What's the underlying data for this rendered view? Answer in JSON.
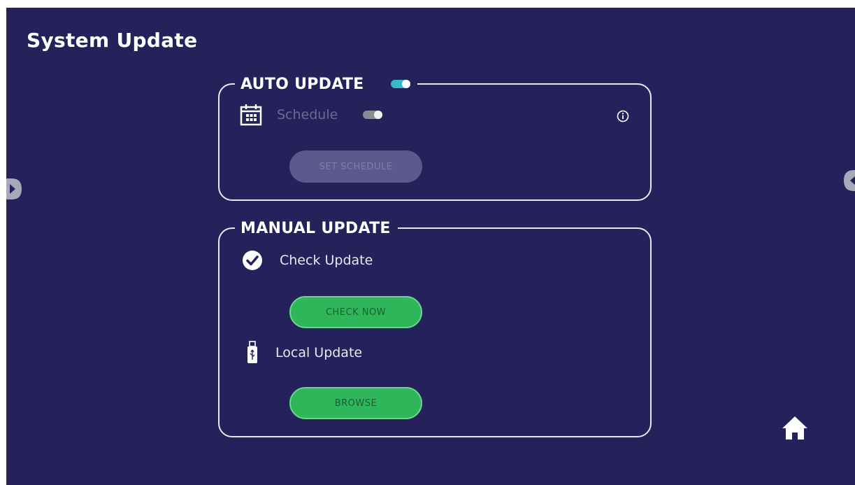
{
  "page": {
    "title": "System Update"
  },
  "auto_update": {
    "title": "AUTO UPDATE",
    "toggle_state": "on",
    "schedule_label": "Schedule",
    "schedule_toggle_state": "off",
    "set_schedule_label": "SET SCHEDULE"
  },
  "manual_update": {
    "title": "MANUAL UPDATE",
    "check_update_label": "Check Update",
    "check_now_label": "CHECK NOW",
    "local_update_label": "Local Update",
    "browse_label": "BROWSE"
  },
  "icons": {
    "calendar": "calendar-icon",
    "info": "info-icon",
    "check": "checkmark-icon",
    "usb": "usb-drive-icon",
    "home": "home-icon",
    "prev": "previous-arrow-icon",
    "next": "next-arrow-icon"
  },
  "colors": {
    "background": "#25215b",
    "toggle_on": "#3bb8c8",
    "toggle_off": "#8a8a92",
    "button_green": "#2fb55a",
    "button_disabled": "#5c5a8d"
  }
}
